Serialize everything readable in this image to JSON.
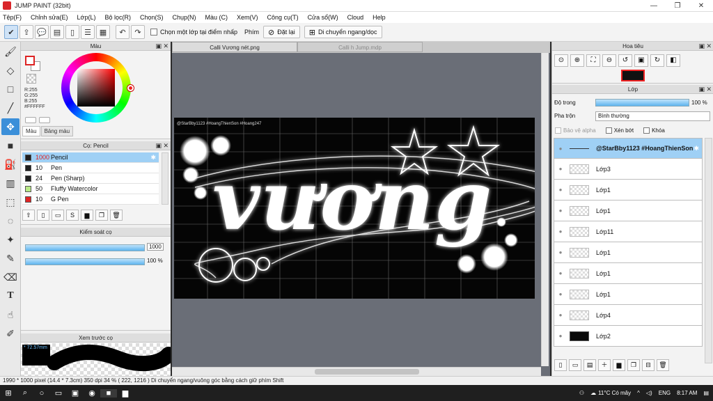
{
  "window": {
    "title": "JUMP PAINT (32bit)"
  },
  "menu": [
    "Tệp(F)",
    "Chỉnh sửa(E)",
    "Lớp(L)",
    "Bộ lọc(R)",
    "Chọn(S)",
    "Chụp(N)",
    "Màu (C)",
    "Xem(V)",
    "Công cụ(T)",
    "Cửa sổ(W)",
    "Cloud",
    "Help"
  ],
  "toolbar": {
    "select_layer_label": "Chọn một lớp tại điểm nhấp",
    "key_label": "Phím",
    "reset_label": "Đặt lại",
    "move_label": "Di chuyển ngang/dọc"
  },
  "color_panel": {
    "title": "Màu",
    "rgb_r": "R:255",
    "rgb_g": "G:255",
    "rgb_b": "B:255",
    "hex": "#FFFFFF",
    "tab_color": "Màu",
    "tab_palette": "Bảng màu"
  },
  "brush_panel": {
    "title": "Cọ: Pencil",
    "brushes": [
      {
        "size": "1000",
        "name": "Pencil",
        "color": "#1e1e1e"
      },
      {
        "size": "10",
        "name": "Pen",
        "color": "#1e1e1e"
      },
      {
        "size": "24",
        "name": "Pen (Sharp)",
        "color": "#1e1e1e"
      },
      {
        "size": "50",
        "name": "Fluffy Watercolor",
        "color": "#b8e986"
      },
      {
        "size": "10",
        "name": "G Pen",
        "color": "#e02424"
      }
    ]
  },
  "brush_control": {
    "title": "Kiểm soát cọ",
    "size_value": "1000",
    "opacity_value": "100 %"
  },
  "preview_panel": {
    "title": "Xem trước cọ",
    "zoom": "* 72.57mm"
  },
  "canvas": {
    "tabs": [
      "Calli Vương nét.png",
      "Calli h Jump.mdp"
    ],
    "watermark": "@StarBby1123 #HoangThienSon #Hoang247",
    "art_text": "vương"
  },
  "navigator": {
    "title": "Hoa tiêu"
  },
  "layer_panel": {
    "title": "Lớp",
    "opacity_label": "Độ trong",
    "opacity_value": "100 %",
    "blend_label": "Pha trộn",
    "blend_value": "Bình thường",
    "protect_alpha": "Bảo vệ alpha",
    "clipping": "Xén bớt",
    "lock": "Khóa",
    "layers": [
      {
        "name": "@StarBby1123 #HoangThienSon",
        "thumb": "line",
        "selected": true
      },
      {
        "name": "Lớp3",
        "thumb": "empty"
      },
      {
        "name": "Lớp1",
        "thumb": "empty"
      },
      {
        "name": "Lớp1",
        "thumb": "empty"
      },
      {
        "name": "Lớp11",
        "thumb": "empty"
      },
      {
        "name": "Lớp1",
        "thumb": "empty"
      },
      {
        "name": "Lớp1",
        "thumb": "empty"
      },
      {
        "name": "Lớp1",
        "thumb": "empty"
      },
      {
        "name": "Lớp4",
        "thumb": "empty"
      },
      {
        "name": "Lớp2",
        "thumb": "dark"
      }
    ]
  },
  "status": {
    "text": "1990 * 1000 pixel   (14.4 * 7.3cm)   350 dpi   34 %   ( 222, 1216 )   Di chuyển ngang/vuông góc bằng cách giữ phím Shift"
  },
  "taskbar": {
    "weather": "11°C  Có mây",
    "lang": "ENG",
    "time": "8:17 AM"
  }
}
